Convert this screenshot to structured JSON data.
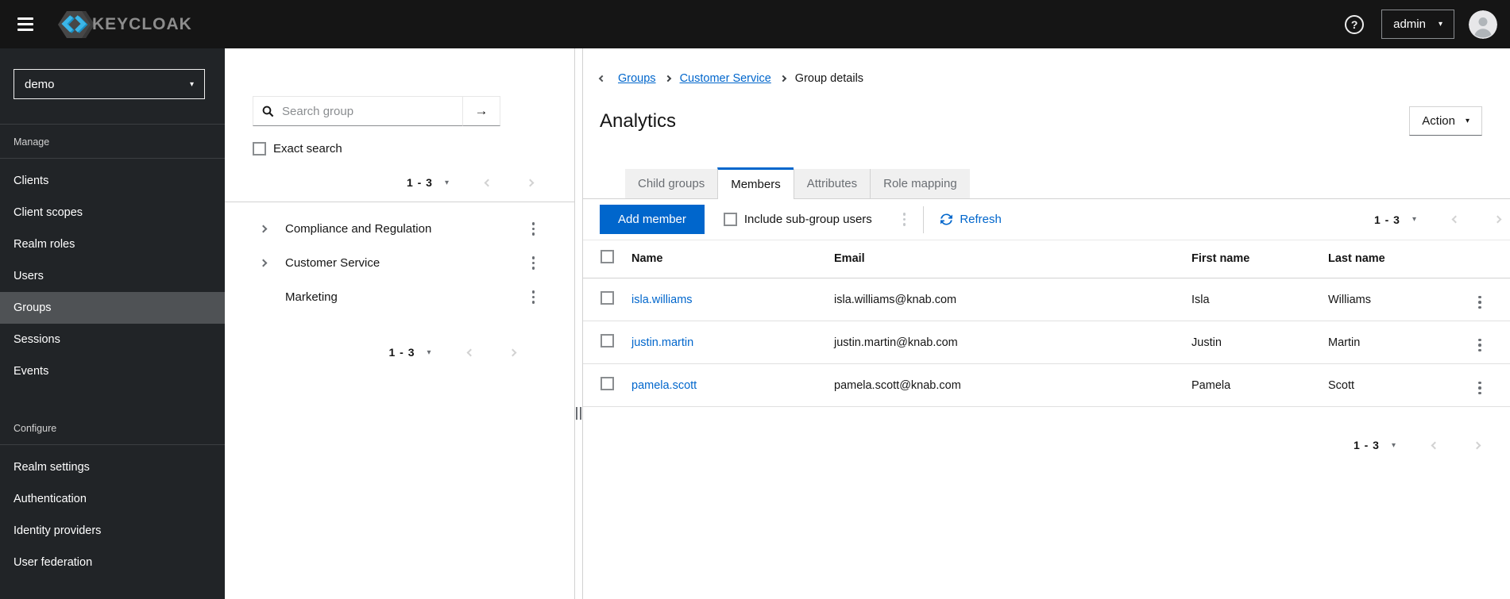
{
  "masthead": {
    "brand": "KEYCLOAK",
    "help_glyph": "?",
    "user_label": "admin"
  },
  "realm_selector": {
    "value": "demo"
  },
  "sidebar": {
    "sections": [
      {
        "label": "Manage",
        "items": [
          {
            "label": "Clients"
          },
          {
            "label": "Client scopes"
          },
          {
            "label": "Realm roles"
          },
          {
            "label": "Users"
          },
          {
            "label": "Groups",
            "selected": true
          },
          {
            "label": "Sessions"
          },
          {
            "label": "Events"
          }
        ]
      },
      {
        "label": "Configure",
        "items": [
          {
            "label": "Realm settings"
          },
          {
            "label": "Authentication"
          },
          {
            "label": "Identity providers"
          },
          {
            "label": "User federation"
          }
        ]
      }
    ]
  },
  "groups_panel": {
    "search": {
      "placeholder": "Search group",
      "submit_glyph": "→"
    },
    "exact_search_label": "Exact search",
    "top_pagination": {
      "range": "1 - 3"
    },
    "tree": [
      {
        "label": "Compliance and Regulation",
        "expandable": true
      },
      {
        "label": "Customer Service",
        "expandable": true
      },
      {
        "label": "Marketing",
        "expandable": false
      }
    ],
    "bottom_pagination": {
      "range": "1 - 3"
    }
  },
  "main": {
    "breadcrumb": {
      "items": [
        {
          "label": "Groups",
          "link": true
        },
        {
          "label": "Customer Service",
          "link": true
        },
        {
          "label": "Group details",
          "link": false
        }
      ]
    },
    "title": "Analytics",
    "action_button_label": "Action",
    "tabs": [
      {
        "label": "Child groups",
        "active": false
      },
      {
        "label": "Members",
        "active": true
      },
      {
        "label": "Attributes",
        "active": false
      },
      {
        "label": "Role mapping",
        "active": false
      }
    ],
    "toolbar": {
      "add_member_label": "Add member",
      "include_subgroups_label": "Include sub-group users",
      "refresh_label": "Refresh",
      "pagination": {
        "range": "1 - 3"
      }
    },
    "members_table": {
      "headers": [
        "Name",
        "Email",
        "First name",
        "Last name"
      ],
      "rows": [
        {
          "username": "isla.williams",
          "email": "isla.williams@knab.com",
          "first_name": "Isla",
          "last_name": "Williams"
        },
        {
          "username": "justin.martin",
          "email": "justin.martin@knab.com",
          "first_name": "Justin",
          "last_name": "Martin"
        },
        {
          "username": "pamela.scott",
          "email": "pamela.scott@knab.com",
          "first_name": "Pamela",
          "last_name": "Scott"
        }
      ],
      "pagination": {
        "range": "1 - 3"
      }
    }
  },
  "colors": {
    "primary_blue": "#0066cc",
    "masthead_bg": "#151515",
    "sidebar_bg": "#212427",
    "sidebar_selected_bg": "#4f5255",
    "link_blue": "#0066cc"
  }
}
